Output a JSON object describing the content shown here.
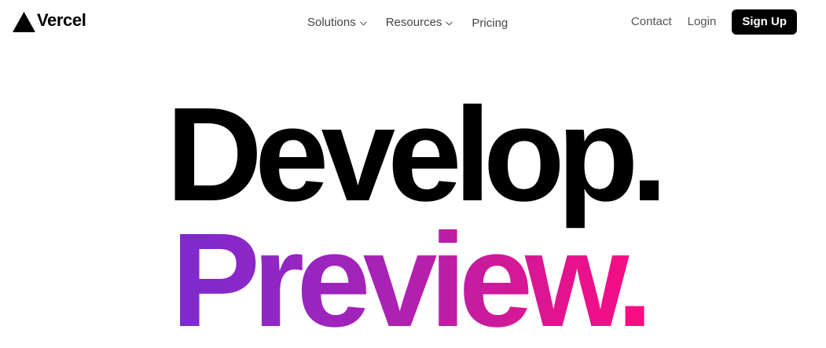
{
  "header": {
    "logo_text": "Vercel",
    "nav": {
      "solutions_label": "Solutions",
      "resources_label": "Resources",
      "pricing_label": "Pricing"
    },
    "contact_label": "Contact",
    "login_label": "Login",
    "signup_label": "Sign Up"
  },
  "hero": {
    "line1": "Develop.",
    "line2": "Preview."
  },
  "colors": {
    "brand": "#000000",
    "gradient_start": "#7b2ad0",
    "gradient_end": "#ff0a80"
  },
  "icons": {
    "logo": "triangle-logo-icon",
    "dropdown": "chevron-down-icon"
  }
}
